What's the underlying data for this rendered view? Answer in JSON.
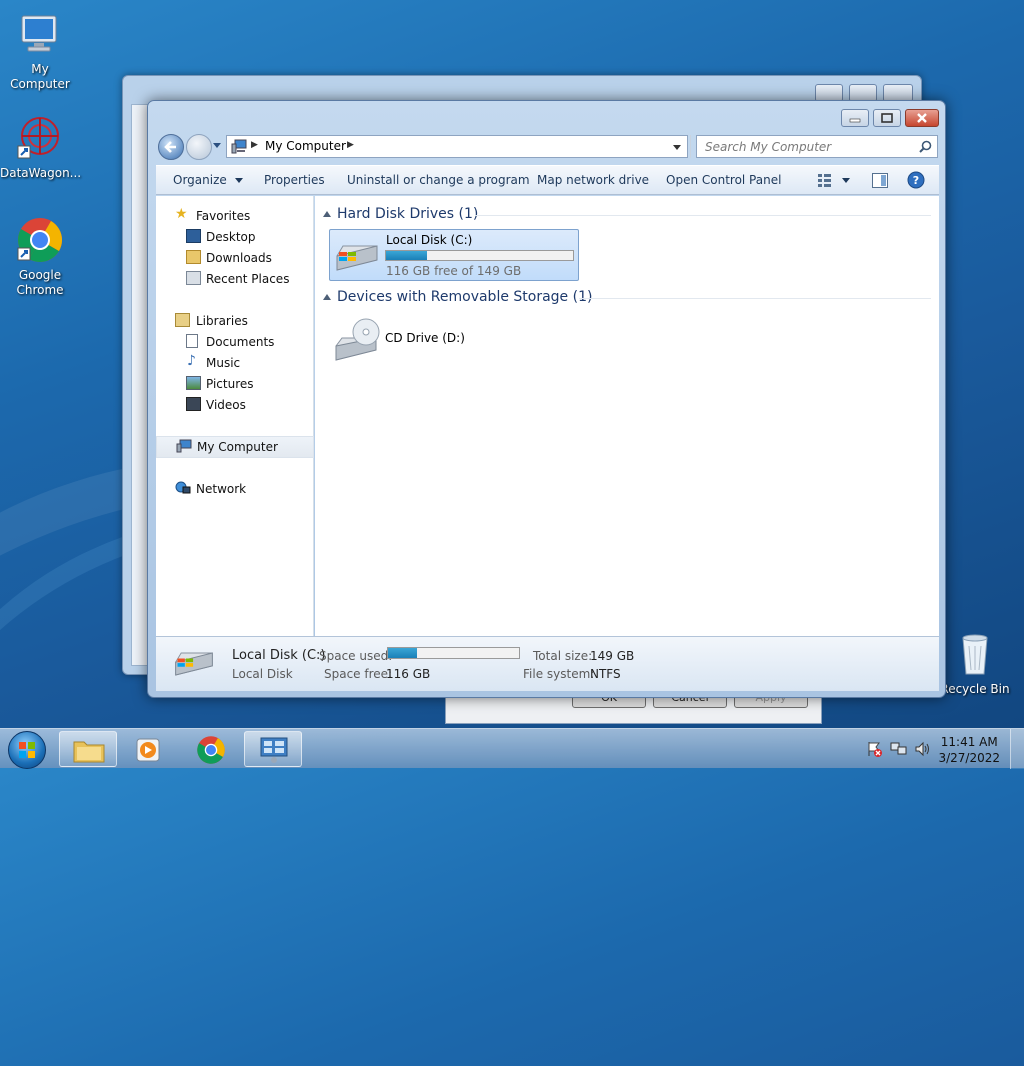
{
  "desktop": {
    "icons": [
      {
        "label": "My Computer"
      },
      {
        "label": "DataWagon..."
      },
      {
        "label": "Google Chrome"
      },
      {
        "label": "Recycle Bin"
      }
    ]
  },
  "background_dialog": {
    "buttons": [
      "OK",
      "Cancel",
      "Apply"
    ]
  },
  "window": {
    "address": {
      "location": "My Computer"
    },
    "search": {
      "placeholder": "Search My Computer"
    },
    "toolbar": {
      "organize": "Organize",
      "properties": "Properties",
      "uninstall": "Uninstall or change a program",
      "map_drive": "Map network drive",
      "control_panel": "Open Control Panel"
    },
    "nav": {
      "favorites": "Favorites",
      "desktop": "Desktop",
      "downloads": "Downloads",
      "recent": "Recent Places",
      "libraries": "Libraries",
      "documents": "Documents",
      "music": "Music",
      "pictures": "Pictures",
      "videos": "Videos",
      "my_computer": "My Computer",
      "network": "Network"
    },
    "groups": {
      "hdd_header": "Hard Disk Drives (1)",
      "removable_header": "Devices with Removable Storage (1)"
    },
    "drives": {
      "c": {
        "name": "Local Disk (C:)",
        "free_text": "116 GB free of 149 GB",
        "used_fraction": 0.22
      },
      "d": {
        "name": "CD Drive (D:)"
      }
    },
    "details": {
      "name": "Local Disk (C:)",
      "type": "Local Disk",
      "space_used_label": "Space used:",
      "space_used_fraction": 0.22,
      "space_free_label": "Space free:",
      "space_free": "116 GB",
      "total_size_label": "Total size:",
      "total_size": "149 GB",
      "file_system_label": "File system:",
      "file_system": "NTFS"
    }
  },
  "taskbar": {
    "time": "11:41 AM",
    "date": "3/27/2022"
  },
  "colors": {
    "accent": "#1e3a6c",
    "usage_bar": "#1a80b7",
    "close_button": "#c6462f"
  }
}
